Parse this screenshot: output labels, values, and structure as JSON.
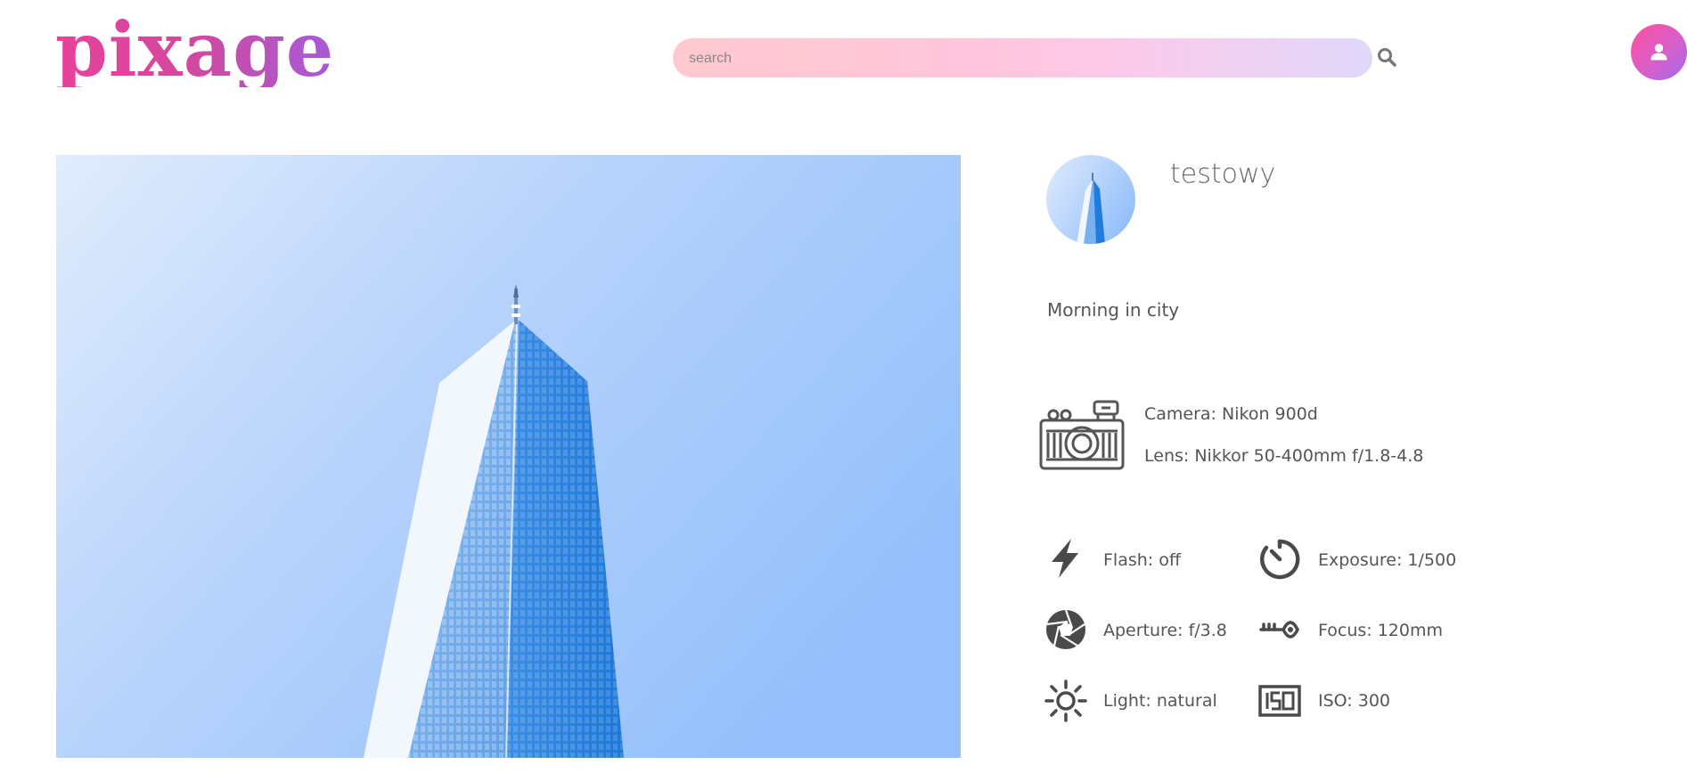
{
  "header": {
    "logo": "pixage",
    "search": {
      "placeholder": "search",
      "value": ""
    },
    "search_icon": "search-icon",
    "profile_icon": "user-icon"
  },
  "photo": {
    "alt_subject": "skyscraper"
  },
  "details": {
    "username": "testowy",
    "caption": "Morning in city",
    "camera": "Camera: Nikon 900d",
    "lens": "Lens: Nikkor 50-400mm f/1.8-4.8",
    "specs": {
      "flash": "Flash: off",
      "exposure": "Exposure: 1/500",
      "aperture": "Aperture: f/3.8",
      "focus": "Focus: 120mm",
      "light": "Light: natural",
      "iso": "ISO: 300"
    }
  },
  "colors": {
    "logo_pink": "#e9419a",
    "logo_purple": "#a55bd8",
    "sky_blue": "#a4c8fb",
    "icon_gray": "#555555"
  }
}
